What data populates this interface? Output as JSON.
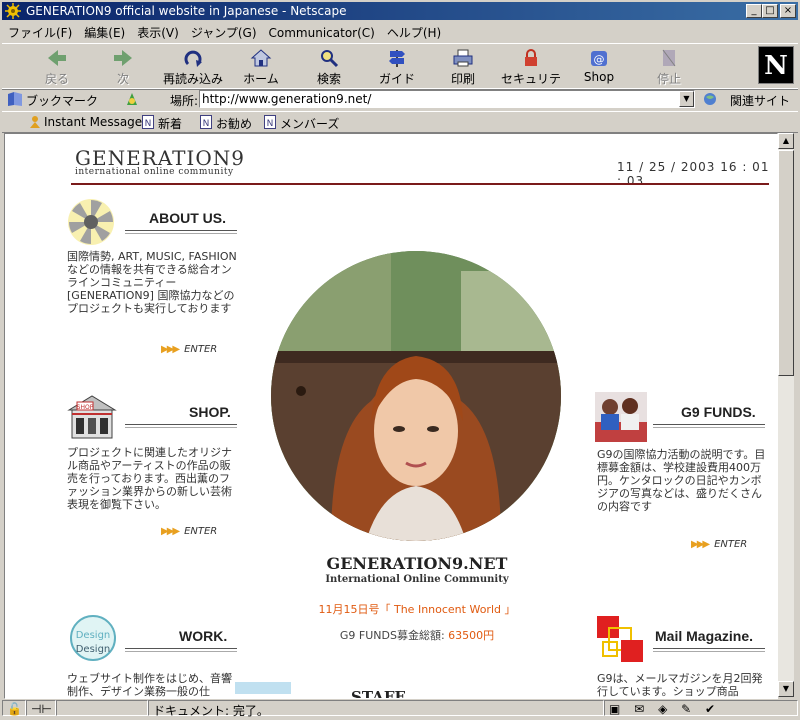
{
  "window": {
    "title": "GENERATION9 official website in Japanese - Netscape"
  },
  "menu": [
    "ファイル(F)",
    "編集(E)",
    "表示(V)",
    "ジャンプ(G)",
    "Communicator(C)",
    "ヘルプ(H)"
  ],
  "toolbar": {
    "back": "戻る",
    "forward": "次",
    "reload": "再読み込み",
    "home": "ホーム",
    "search": "検索",
    "guide": "ガイド",
    "print": "印刷",
    "security": "セキュリティ",
    "shop": "Shop",
    "stop": "停止",
    "brand": "N"
  },
  "location": {
    "bookmarks": "ブックマーク",
    "label": "場所:",
    "url": "http://www.generation9.net/",
    "related": "関連サイト"
  },
  "personal": [
    "Instant Message",
    "新着",
    "お勧め",
    "メンバーズ"
  ],
  "page": {
    "logo": "GENERATION9",
    "logo_sub": "international online community",
    "date": "11 / 25 / 2003   16 : 01 : 03",
    "about": {
      "title": "ABOUT US.",
      "text": "国際情勢, ART, MUSIC, FASHIONなどの情報を共有できる総合オンラインコミュニティー[GENERATION9] 国際協力などのプロジェクトも実行しております",
      "enter": "ENTER"
    },
    "shop": {
      "title": "SHOP.",
      "icon_label": "SHOP",
      "text": "プロジェクトに関連したオリジナル商品やアーティストの作品の販売を行っております。西出薫のファッション業界からの新しい芸術表現を御覧下さい。",
      "enter": "ENTER"
    },
    "work": {
      "title": "WORK.",
      "icon_label_1": "Design",
      "icon_label_2": "Design",
      "text": "ウェブサイト制作をはじめ、音響制作、デザイン業務一般の仕"
    },
    "funds": {
      "title": "G9 FUNDS.",
      "text": "G9の国際協力活動の説明です。目標募金額は、学校建設費用400万円。ケンタロックの日記やカンボジアの写真などは、盛りだくさんの内容です",
      "enter": "ENTER"
    },
    "mail": {
      "title": "Mail Magazine.",
      "text": "G9は、メールマガジンを月2回発行しています。ショップ商品"
    },
    "center_title": "GENERATION9.NET",
    "center_sub": "International Online Community",
    "issue": "11月15日号「 The Innocent World 」",
    "funds_label": "G9 FUNDS募金総額: ",
    "funds_amount": "63500円",
    "staff_partial": "STAFF"
  },
  "status": {
    "text": "ドキュメント: 完了。"
  },
  "colors": {
    "title_bar": "#0a246a",
    "accent": "#e05a10",
    "rule": "#7a1a1a"
  }
}
